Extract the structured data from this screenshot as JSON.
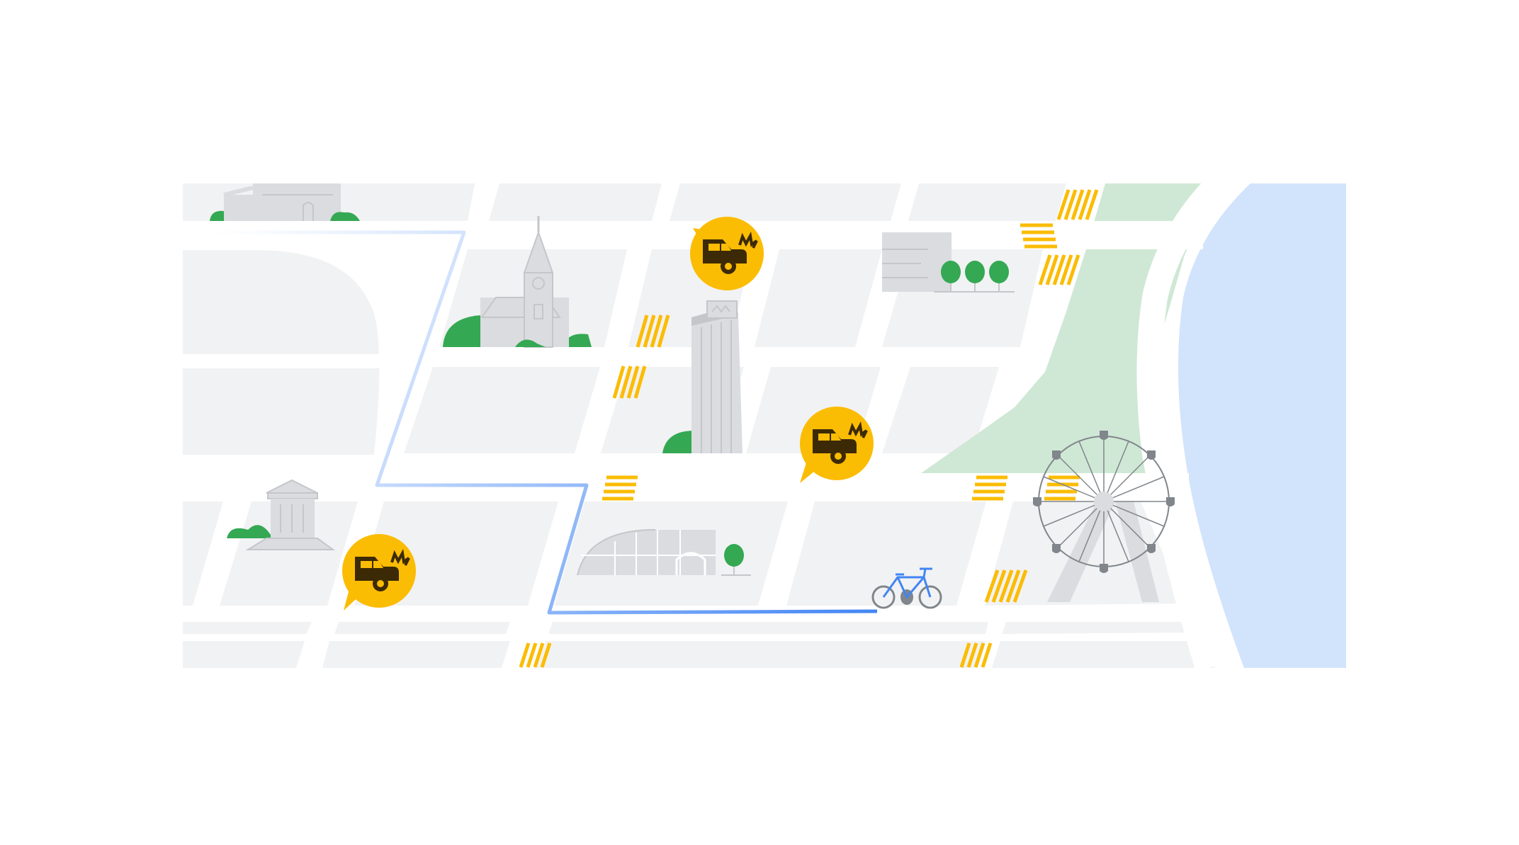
{
  "map": {
    "colors": {
      "block": "#f1f2f3",
      "road": "#ffffff",
      "building": "#dadce0",
      "building_line": "#c4c6ca",
      "park": "#cfe8d5",
      "water": "#d2e3fc",
      "tree": "#34a853",
      "crosswalk": "#fbbc04",
      "alert_bubble": "#fbbc04",
      "alert_icon": "#3c2a06",
      "route": "#4285f4",
      "bike": "#4285f4",
      "wheel": "#80868b"
    },
    "route": {
      "mode": "bicycle"
    },
    "alerts": [
      {
        "type": "crash",
        "icon": "crash-icon"
      },
      {
        "type": "crash",
        "icon": "crash-icon"
      },
      {
        "type": "crash",
        "icon": "crash-icon"
      }
    ],
    "landmarks": [
      "church",
      "office-tower",
      "museum",
      "greenhouse",
      "warehouse",
      "ferris-wheel",
      "hall"
    ]
  }
}
